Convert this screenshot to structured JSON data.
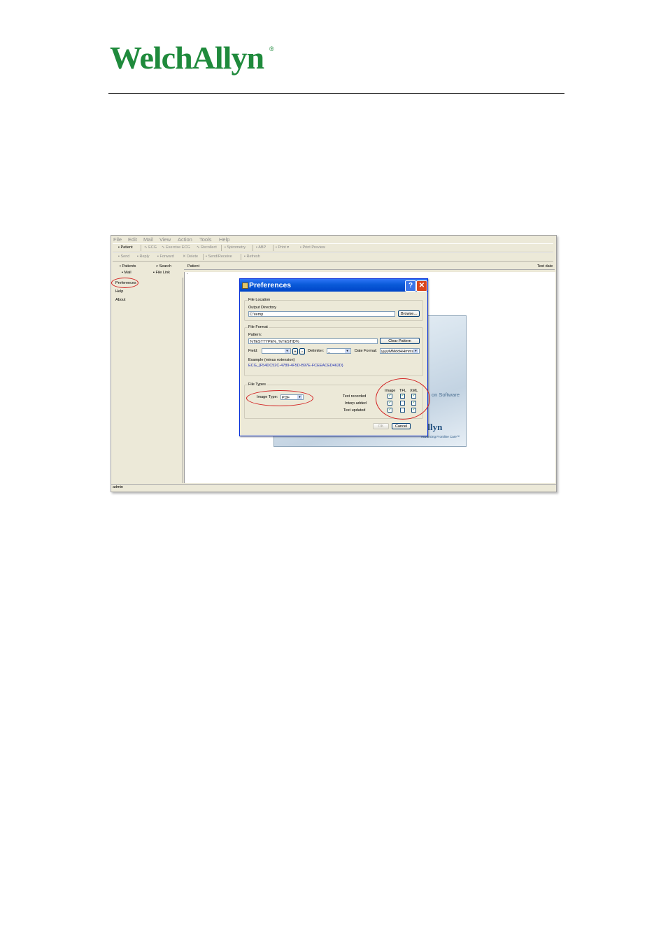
{
  "brand": {
    "logo_text": "WelchAllyn",
    "registered": "®"
  },
  "app": {
    "menu": [
      "File",
      "Edit",
      "Mail",
      "View",
      "Action",
      "Tools",
      "Help"
    ],
    "toolbar1": [
      "Patient",
      "ECG",
      "Exercise ECG",
      "Recollect",
      "Spirometry",
      "ABP",
      "Print",
      "Print Preview"
    ],
    "toolbar2": [
      "Send",
      "Reply",
      "Forward",
      "Delete",
      "Send/Receive",
      "Refresh"
    ],
    "nav": {
      "patients": "Patients",
      "search": "Search",
      "mail": "Mail",
      "file_link": "File Link"
    },
    "left_items": [
      "Preferences",
      "Help",
      "About"
    ],
    "columns": {
      "patient": "Patient",
      "test_date": "Test date"
    },
    "row_marker": "-",
    "status_user": "admin"
  },
  "splash": {
    "software_text": "on Software",
    "logo": "Allyn",
    "tagline": "Advancing Frontline Care™"
  },
  "dialog": {
    "title": "Preferences",
    "help_label": "?",
    "close_label": "✕",
    "file_location": {
      "group_label": "File Location",
      "output_dir_label": "Output Directory",
      "output_dir_value": "C:\\temp",
      "browse_label": "Browse..."
    },
    "file_format": {
      "group_label": "File Format",
      "pattern_label": "Pattern:",
      "pattern_value": "%TESTTYPE%_%TESTID%",
      "clear_pattern_label": "Clear Pattern",
      "field_label": "Field:",
      "add_label": "+",
      "remove_label": "-",
      "delimiter_label": "Delimiter:",
      "delimiter_value": "_",
      "date_format_label": "Date Format:",
      "date_format_value": "yyyyMMddHHmmss",
      "example_label": "Example (minus extension)",
      "example_value": "ECG_{F54DC52C-4789-4F5D-B97E-FCEEACED462D}"
    },
    "file_types": {
      "group_label": "File Types",
      "image_type_label": "Image Type:",
      "image_type_value": "PDF",
      "col_headers": [
        "Image",
        "TFL",
        "XML"
      ],
      "rows": [
        {
          "label": "Test recorded",
          "checks": [
            true,
            true,
            true
          ]
        },
        {
          "label": "Interp added",
          "checks": [
            true,
            false,
            true
          ]
        },
        {
          "label": "Test updated",
          "checks": [
            true,
            false,
            true
          ]
        }
      ]
    },
    "ok_label": "OK",
    "cancel_label": "Cancel"
  }
}
